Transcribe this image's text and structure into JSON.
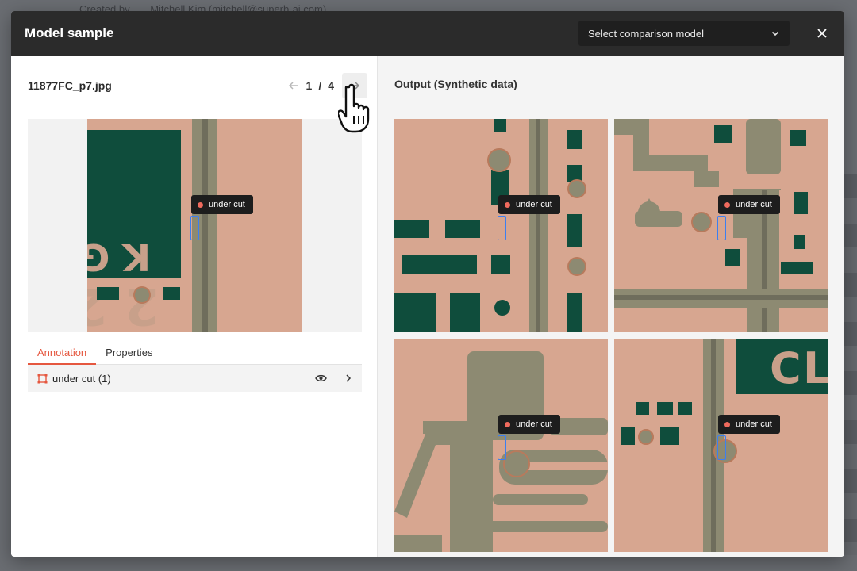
{
  "background": {
    "created_by_label": "Created by",
    "created_by_value": "Mitchell Kim (mitchell@superb-ai.com)"
  },
  "modal": {
    "title": "Model sample",
    "compare_select": {
      "placeholder": "Select comparison model",
      "icon": "chevron-down-icon"
    },
    "close_icon": "close-icon"
  },
  "left": {
    "file_name": "11877FC_p7.jpg",
    "pager": {
      "current": "1",
      "separator": "/",
      "total": "4",
      "prev_icon": "arrow-left-icon",
      "next_icon": "arrow-right-icon"
    },
    "image_tag": "under cut",
    "tabs": [
      {
        "label": "Annotation",
        "active": true
      },
      {
        "label": "Properties",
        "active": false
      }
    ],
    "annotations": [
      {
        "label": "under cut (1)",
        "icon": "bounding-box-icon",
        "color": "#e5573f"
      }
    ]
  },
  "right": {
    "title": "Output (Synthetic data)",
    "tiles": [
      {
        "tag": "under cut"
      },
      {
        "tag": "under cut"
      },
      {
        "tag": "under cut"
      },
      {
        "tag": "under cut"
      }
    ]
  },
  "colors": {
    "accent": "#e5573f",
    "header_bg": "#2b2b2b",
    "box_stroke": "#3d7ff0",
    "copper": "#d4a18a",
    "trace": "#8d8a72",
    "mask": "#0f4d3c"
  }
}
